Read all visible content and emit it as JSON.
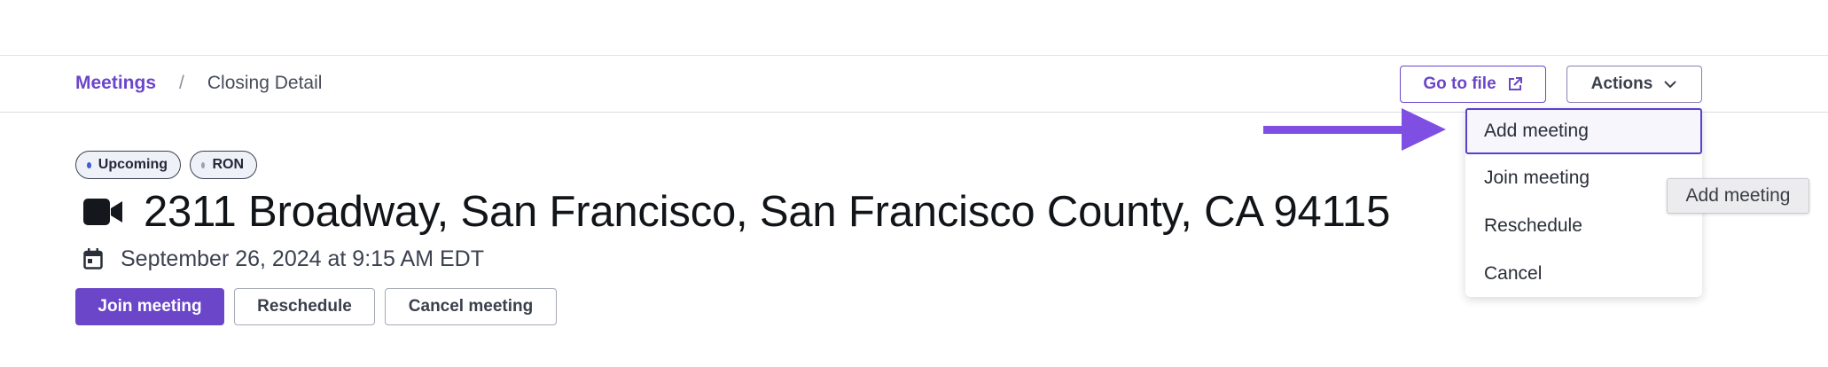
{
  "breadcrumb": {
    "root": "Meetings",
    "separator": "/",
    "current": "Closing Detail"
  },
  "header": {
    "go_to_file": "Go to file",
    "actions": "Actions"
  },
  "dropdown": {
    "items": [
      "Add meeting",
      "Join meeting",
      "Reschedule",
      "Cancel"
    ]
  },
  "tooltip": "Add meeting",
  "badges": [
    {
      "label": "Upcoming",
      "dot_color": "#3f5bd6"
    },
    {
      "label": "RON",
      "dot_color": "#a0a3ad"
    }
  ],
  "meeting": {
    "address": "2311 Broadway, San Francisco, San Francisco County, CA 94115",
    "datetime": "September 26, 2024 at 9:15 AM EDT"
  },
  "buttons": {
    "join": "Join meeting",
    "reschedule": "Reschedule",
    "cancel": "Cancel meeting"
  },
  "colors": {
    "accent": "#6b46c9",
    "arrow": "#7f4fe4"
  },
  "icons": {
    "external_link": "external-link-icon",
    "chevron": "chevron-down-icon",
    "video": "video-camera-icon",
    "calendar": "calendar-icon"
  }
}
